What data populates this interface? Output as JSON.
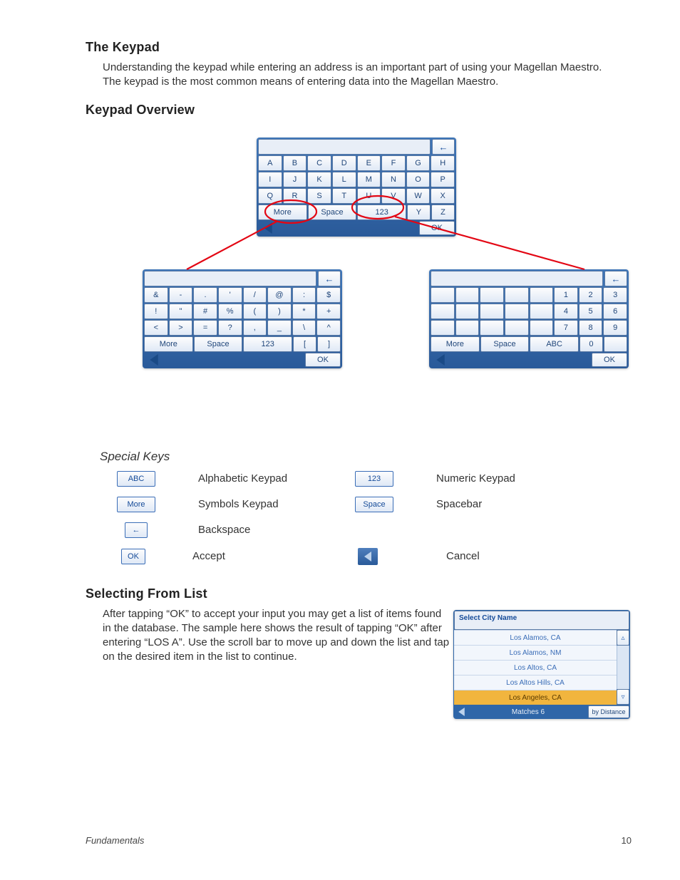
{
  "headings": {
    "h1": "The Keypad",
    "h2": "Keypad Overview",
    "h3": "Selecting From List"
  },
  "para1": "Understanding the keypad while entering an address is an important part of using your Magellan Maestro.  The keypad is the most common means of entering data into the Magellan Maestro.",
  "specialKeysHead": "Special Keys",
  "para2": "After tapping “OK” to accept your input you may get a list of items found in the database.  The sample here shows the result of tapping “OK” after entering “LOS A”.  Use the scroll bar to move up and down the list and tap on the desired item in the list to continue.",
  "keypads": {
    "alpha": {
      "backspace": "←",
      "rows": [
        [
          "A",
          "B",
          "C",
          "D",
          "E",
          "F",
          "G",
          "H"
        ],
        [
          "I",
          "J",
          "K",
          "L",
          "M",
          "N",
          "O",
          "P"
        ],
        [
          "Q",
          "R",
          "S",
          "T",
          "U",
          "V",
          "W",
          "X"
        ]
      ],
      "bottom": {
        "more": "More",
        "space": "Space",
        "num": "123",
        "y": "Y",
        "z": "Z"
      },
      "ok": "OK"
    },
    "symbols": {
      "backspace": "←",
      "rows": [
        [
          "&",
          "-",
          ".",
          "'",
          "/",
          "@",
          ":",
          "$"
        ],
        [
          "!",
          "\"",
          "#",
          "%",
          "(",
          ")",
          "*",
          "+"
        ],
        [
          "<",
          ">",
          "=",
          "?",
          ",",
          "_",
          "\\",
          "^"
        ]
      ],
      "bottom": {
        "more": "More",
        "space": "Space",
        "num": "123",
        "l": "[",
        "r": "]"
      },
      "ok": "OK"
    },
    "numeric": {
      "backspace": "←",
      "rows": [
        [
          "",
          "",
          "",
          "",
          "",
          "1",
          "2",
          "3"
        ],
        [
          "",
          "",
          "",
          "",
          "",
          "4",
          "5",
          "6"
        ],
        [
          "",
          "",
          "",
          "",
          "",
          "7",
          "8",
          "9"
        ]
      ],
      "bottom": {
        "more": "More",
        "space": "Space",
        "abc": "ABC",
        "zero": "0",
        "blank": ""
      },
      "ok": "OK"
    }
  },
  "special": {
    "abc": {
      "btn": "ABC",
      "label": "Alphabetic Keypad"
    },
    "num": {
      "btn": "123",
      "label": "Numeric Keypad"
    },
    "more": {
      "btn": "More",
      "label": "Symbols Keypad"
    },
    "space": {
      "btn": "Space",
      "label": "Spacebar"
    },
    "bs": {
      "btn": "←",
      "label": "Backspace"
    },
    "ok": {
      "btn": "OK",
      "label": "Accept"
    },
    "cancel": {
      "label": "Cancel"
    }
  },
  "citylist": {
    "header": "Select City Name",
    "rows": [
      "Los Alamos, CA",
      "Los Alamos, NM",
      "Los Altos, CA",
      "Los Altos Hills, CA",
      "Los Angeles, CA"
    ],
    "selectedIndex": 4,
    "matches": "Matches  6",
    "byDistance": "by Distance"
  },
  "footer": {
    "section": "Fundamentals",
    "page": "10"
  }
}
